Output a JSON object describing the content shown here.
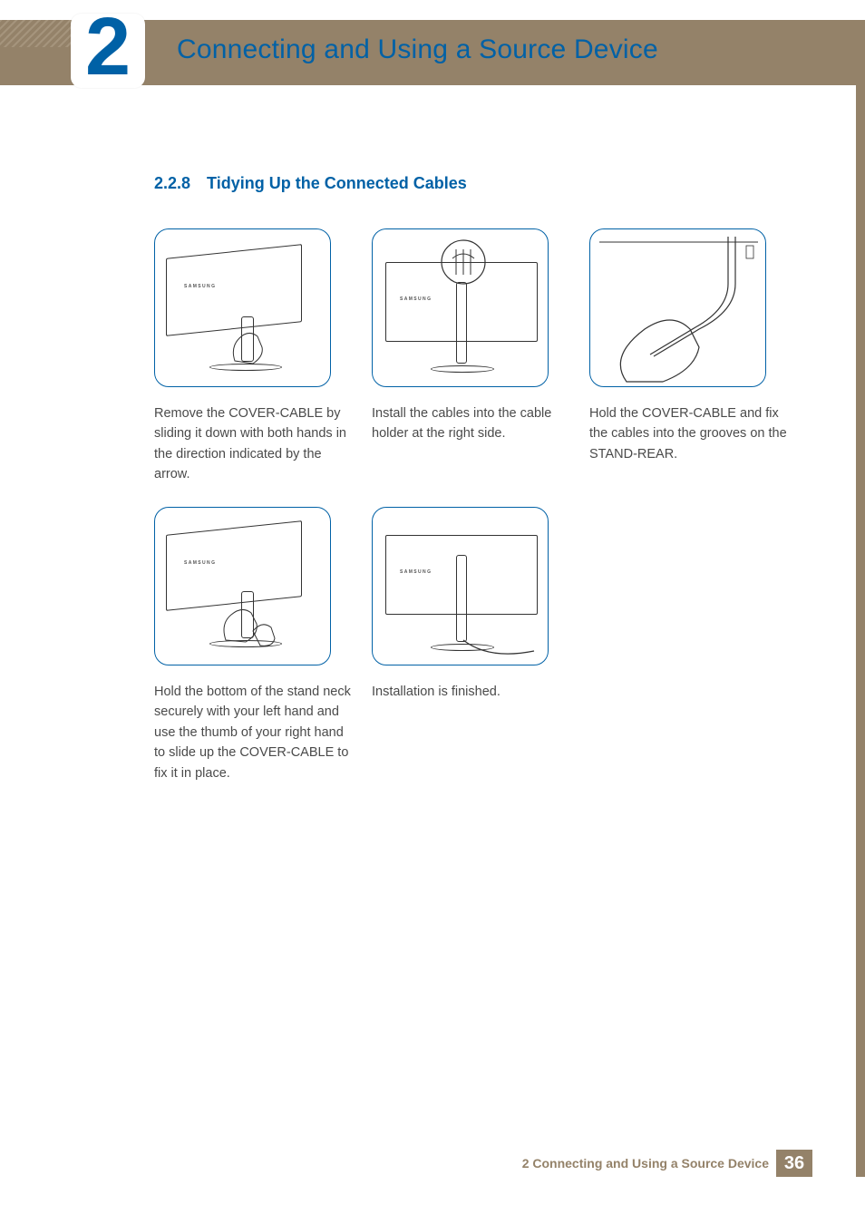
{
  "header": {
    "chapter_number": "2",
    "chapter_title": "Connecting and Using a Source Device"
  },
  "section": {
    "number": "2.2.8",
    "title": "Tidying Up the Connected Cables"
  },
  "steps": [
    {
      "caption": "Remove the COVER-CABLE by sliding it down with both hands in the direction indicated by the arrow."
    },
    {
      "caption": "Install the cables into the cable holder at the right side."
    },
    {
      "caption": "Hold the COVER-CABLE and fix the cables into the grooves on the STAND-REAR."
    },
    {
      "caption": "Hold the bottom of the stand neck securely with your left hand and use the thumb of your right hand to slide up the COVER-CABLE to fix it in place."
    },
    {
      "caption": "Installation is finished."
    }
  ],
  "illustration_label": "SAMSUNG",
  "footer": {
    "title": "2 Connecting and Using a Source Device",
    "page": "36"
  }
}
